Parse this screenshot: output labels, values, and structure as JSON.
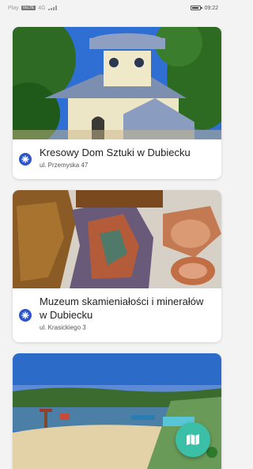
{
  "status_bar": {
    "carrier": "Play",
    "network_badge": "VoLTE",
    "network_type": "4G",
    "time": "09:22"
  },
  "places": [
    {
      "title": "Kresowy Dom Sztuki w Dubiecku",
      "address": "ul. Przemyska 47",
      "icon": "location-pin-icon"
    },
    {
      "title": "Muzeum skamieniałości i minerałów w Dubiecku",
      "address": "ul. Krasickiego 3",
      "icon": "location-pin-icon"
    },
    {
      "title": "",
      "address": "",
      "icon": "location-pin-icon"
    }
  ],
  "fab": {
    "icon": "map-icon"
  },
  "colors": {
    "accent": "#2c56c9",
    "fab": "#3bbfa6",
    "background": "#f3f3f3"
  }
}
